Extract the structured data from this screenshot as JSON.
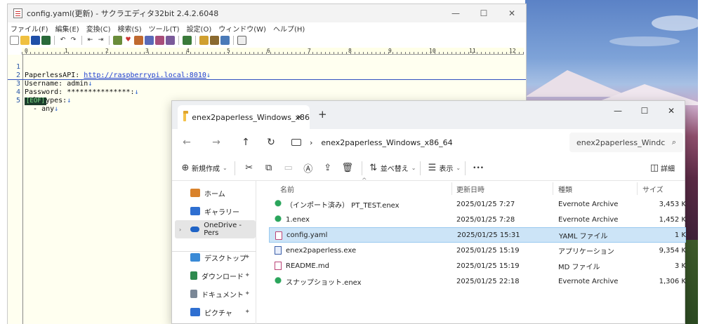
{
  "sakura": {
    "title": "config.yaml(更新) - サクラエディタ32bit 2.4.2.6048",
    "window_controls": {
      "minimize": "—",
      "maximize": "☐",
      "close": "✕"
    },
    "menu": [
      "ファイル(F)",
      "編集(E)",
      "変換(C)",
      "検索(S)",
      "ツール(T)",
      "設定(O)",
      "ウィンドウ(W)",
      "ヘルプ(H)"
    ],
    "ruler": [
      "0",
      "1",
      "2",
      "3",
      "4",
      "5",
      "6",
      "7",
      "8",
      "9",
      "10",
      "11",
      "12"
    ],
    "lines": [
      {
        "num": "1",
        "prefix": "PaperlessAPI: ",
        "url": "http://raspberrypi.local:8010",
        "eol": "↓"
      },
      {
        "num": "2",
        "prefix": "Username: admin",
        "url": "",
        "eol": "↓"
      },
      {
        "num": "3",
        "prefix": "Password: ***************:",
        "url": "",
        "eol": "↓"
      },
      {
        "num": "4",
        "prefix": "FileTypes:",
        "url": "",
        "eol": "↓"
      },
      {
        "num": "5",
        "prefix": "  - any",
        "url": "",
        "eol": "↓"
      }
    ],
    "eof": "[EOF]"
  },
  "explorer": {
    "tab_label": "enex2paperless_Windows_x86",
    "tab_close": "✕",
    "new_tab": "+",
    "window_controls": {
      "minimize": "—",
      "maximize": "☐",
      "close": "✕"
    },
    "nav": {
      "back": "←",
      "forward": "→",
      "up": "↑",
      "refresh": "↻",
      "sep": "›"
    },
    "address": "enex2paperless_Windows_x86_64",
    "search_placeholder": "enex2paperless_Windc",
    "search_icon": "⌕",
    "commands": {
      "new": "新規作成",
      "sort": "並べ替え",
      "view": "表示",
      "more": "•••",
      "details": "詳細"
    },
    "sidebar": [
      {
        "label": "ホーム",
        "color": "#d9822b"
      },
      {
        "label": "ギャラリー",
        "color": "#2f6fd1"
      },
      {
        "label": "OneDrive - Pers",
        "color": "#1f63c6"
      },
      {
        "label": "デスクトップ",
        "color": "#3a8ad6"
      },
      {
        "label": "ダウンロード",
        "color": "#2d8a4e"
      },
      {
        "label": "ドキュメント",
        "color": "#7a8796"
      },
      {
        "label": "ピクチャ",
        "color": "#2f6fd1"
      }
    ],
    "columns": {
      "name": "名前",
      "date": "更新日時",
      "type": "種類",
      "size": "サイズ"
    },
    "files": [
      {
        "name": "（インポート済み） PT_TEST.enex",
        "date": "2025/01/25 7:27",
        "type": "Evernote Archive",
        "size": "3,453 K",
        "icon": "enex"
      },
      {
        "name": "1.enex",
        "date": "2025/01/25 7:28",
        "type": "Evernote Archive",
        "size": "1,452 K",
        "icon": "enex"
      },
      {
        "name": "config.yaml",
        "date": "2025/01/25 15:31",
        "type": "YAML ファイル",
        "size": "1 K",
        "icon": "yaml"
      },
      {
        "name": "enex2paperless.exe",
        "date": "2025/01/25 15:19",
        "type": "アプリケーション",
        "size": "9,354 K",
        "icon": "exe"
      },
      {
        "name": "README.md",
        "date": "2025/01/25 15:19",
        "type": "MD ファイル",
        "size": "3 K",
        "icon": "md"
      },
      {
        "name": "スナップショット.enex",
        "date": "2025/01/25 22:18",
        "type": "Evernote Archive",
        "size": "1,306 K",
        "icon": "enex"
      }
    ]
  }
}
